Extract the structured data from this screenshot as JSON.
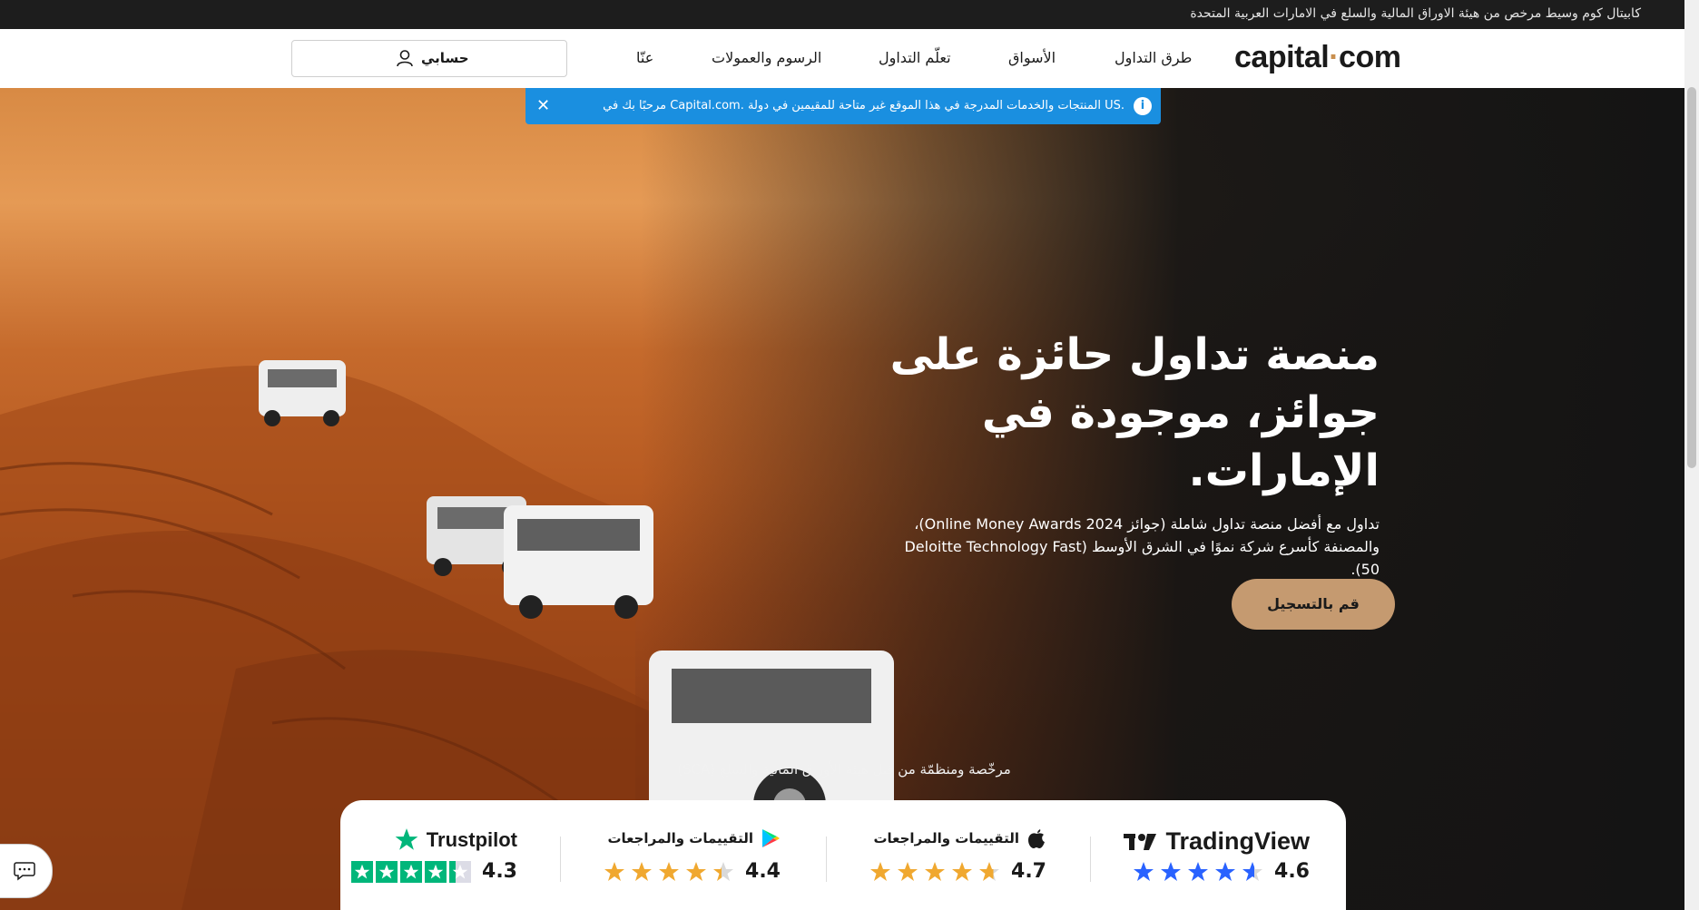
{
  "topbar": {
    "text": "كابيتال كوم وسيط مرخص من هيئة الاوراق المالية والسلع في الامارات العربية المتحدة"
  },
  "nav": {
    "logo_text_1": "capital",
    "logo_dot": "·",
    "logo_text_2": "com",
    "items": [
      "طرق التداول",
      "الأسواق",
      "تعلّم التداول",
      "الرسوم والعمولات",
      "عنّا"
    ],
    "account_label": "حسابي"
  },
  "notice": {
    "text": "مرحبًا بك في Capital.com. المنتجات والخدمات المدرجة في هذا الموقع غير متاحة للمقيمين في دولة US.",
    "info_icon": "i",
    "close_icon": "✕"
  },
  "hero": {
    "title": "منصة تداول حائزة على جوائز، موجودة في الإمارات.",
    "subtitle": "تداول مع أفضل منصة تداول شاملة (جوائز Online Money Awards 2024)، والمصنفة كأسرع شركة نموًا في الشرق الأوسط (Deloitte Technology Fast 50).",
    "cta": "قم بالتسجيل",
    "licensed": "مرخّصة ومنظمّة من قبل هيئة الأوراق المالية والسلع (SCA)"
  },
  "ratings": [
    {
      "brand": "TradingView",
      "title": "",
      "score": "4.6",
      "stars": 4.6,
      "color": "#2962ff"
    },
    {
      "brand": "",
      "title": "التقييمات والمراجعات",
      "score": "4.7",
      "stars": 4.7,
      "color": "#f0a830",
      "icon": "apple-icon"
    },
    {
      "brand": "",
      "title": "التقييمات والمراجعات",
      "score": "4.4",
      "stars": 4.4,
      "color": "#f0a830",
      "icon": "google-play-icon"
    },
    {
      "brand": "Trustpilot",
      "title": "",
      "score": "4.3",
      "stars": 4.3,
      "color": "#00b67a"
    }
  ],
  "colors": {
    "accent": "#c59a70",
    "notice": "#1a8fe0"
  }
}
